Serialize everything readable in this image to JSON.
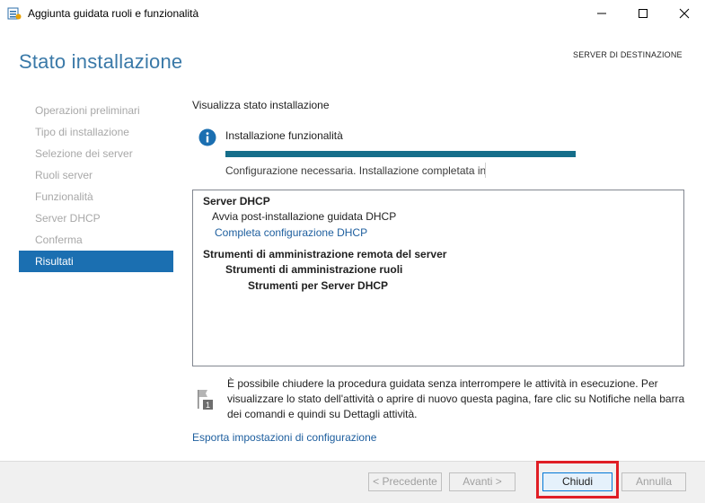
{
  "window": {
    "title": "Aggiunta guidata ruoli e funzionalità",
    "controls": [
      "minimize-icon",
      "maximize-icon",
      "close-icon"
    ]
  },
  "header": {
    "page_title": "Stato installazione",
    "destination_label": "SERVER DI DESTINAZIONE"
  },
  "sidebar": {
    "items": [
      {
        "label": "Operazioni preliminari",
        "active": false
      },
      {
        "label": "Tipo di installazione",
        "active": false
      },
      {
        "label": "Selezione dei server",
        "active": false
      },
      {
        "label": "Ruoli server",
        "active": false
      },
      {
        "label": "Funzionalità",
        "active": false
      },
      {
        "label": "Server DHCP",
        "active": false
      },
      {
        "label": "Conferma",
        "active": false
      },
      {
        "label": "Risultati",
        "active": true
      }
    ]
  },
  "main": {
    "section_title": "Visualizza stato installazione",
    "status_heading": "Installazione funzionalità",
    "progress_fraction": 1.0,
    "status_text": "Configurazione necessaria. Installazione completata in",
    "results": {
      "dhcp_header": "Server DHCP",
      "dhcp_sub": "Avvia post-installazione guidata DHCP",
      "dhcp_link": "Completa configurazione DHCP",
      "rsat_header": "Strumenti di amministrazione remota del server",
      "rsat_roles": "Strumenti di amministrazione ruoli",
      "rsat_dhcp": "Strumenti per Server DHCP"
    },
    "note_line1": "È possibile chiudere la procedura guidata senza interrompere le attività in esecuzione. Per",
    "note_line2": "visualizzare lo stato dell'attività o aprire di nuovo questa pagina, fare clic su Notifiche nella barra",
    "note_line3": "dei comandi e quindi su Dettagli attività.",
    "export_link": "Esporta impostazioni di configurazione"
  },
  "footer": {
    "prev_label": "< Precedente",
    "next_label": "Avanti >",
    "close_label": "Chiudi",
    "cancel_label": "Annulla"
  },
  "colors": {
    "accent": "#1b6fb1",
    "title_blue": "#3a79a8",
    "progress": "#156e8a",
    "link": "#1d5e9e",
    "highlight": "#e01e25"
  }
}
